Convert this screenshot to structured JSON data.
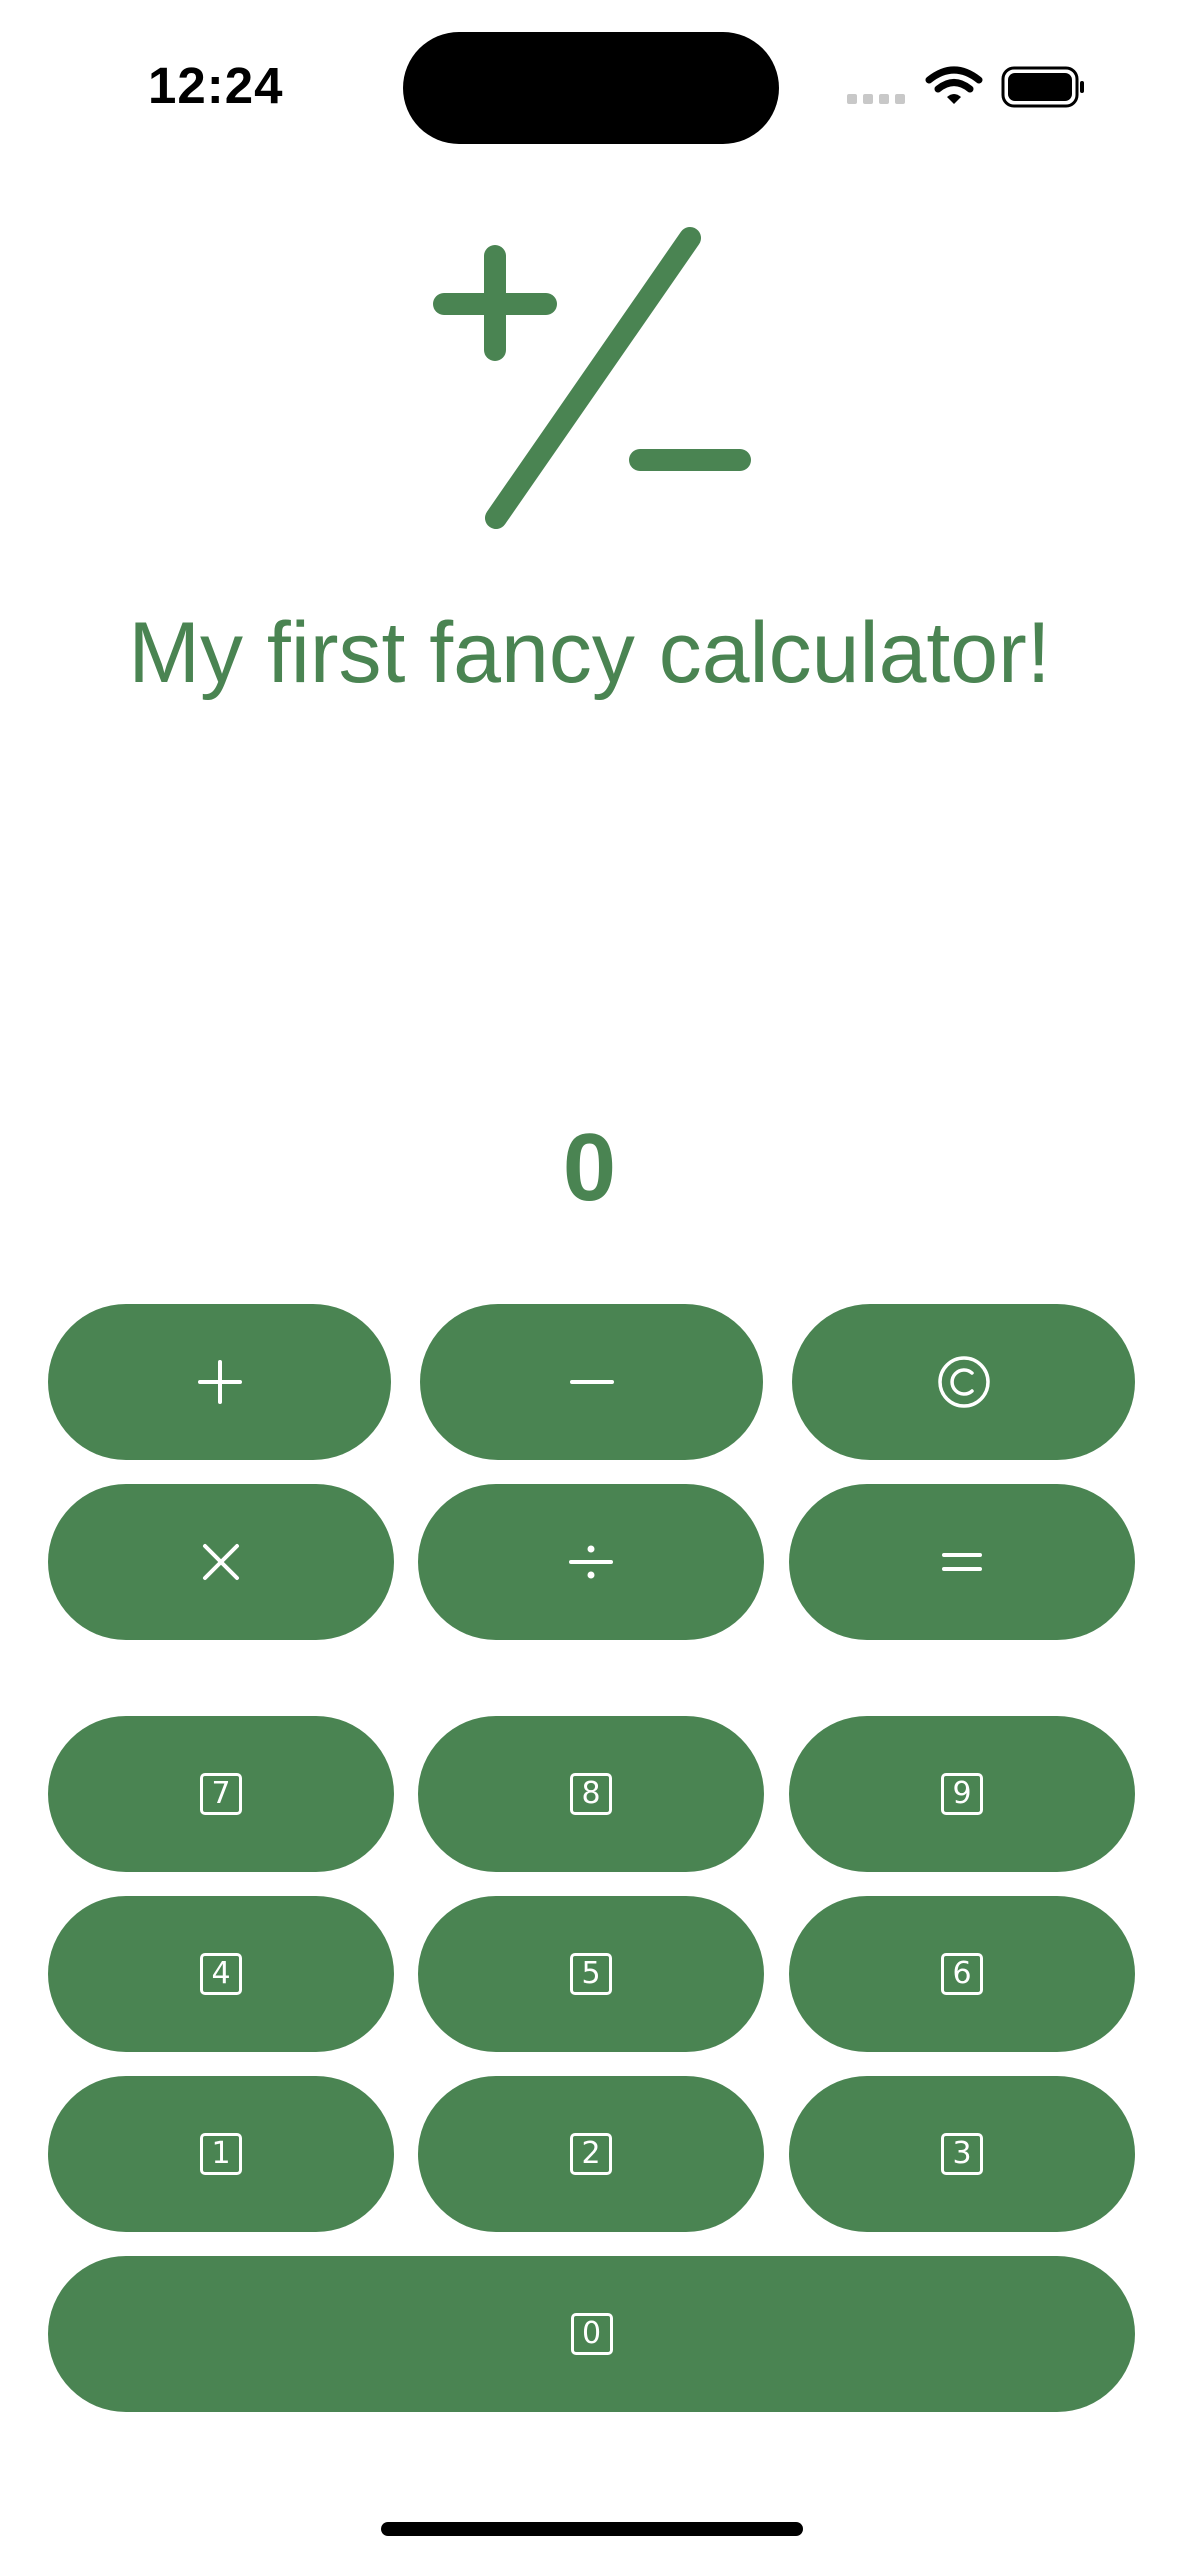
{
  "status_bar": {
    "time": "12:24"
  },
  "header": {
    "logo_icon": "plus-slash-minus-icon",
    "title": "My first fancy calculator!"
  },
  "display": {
    "value": "0"
  },
  "operators": [
    {
      "name": "plus",
      "icon": "plus-icon"
    },
    {
      "name": "minus",
      "icon": "minus-icon"
    },
    {
      "name": "clear",
      "icon": "c-circle-icon"
    },
    {
      "name": "multiply",
      "icon": "multiply-icon"
    },
    {
      "name": "divide",
      "icon": "divide-icon"
    },
    {
      "name": "equals",
      "icon": "equals-icon"
    }
  ],
  "digits": {
    "d7": "7",
    "d8": "8",
    "d9": "9",
    "d4": "4",
    "d5": "5",
    "d6": "6",
    "d1": "1",
    "d2": "2",
    "d3": "3",
    "d0": "0"
  },
  "colors": {
    "accent": "#4a8452",
    "background": "#ffffff",
    "button_text": "#ffffff"
  }
}
